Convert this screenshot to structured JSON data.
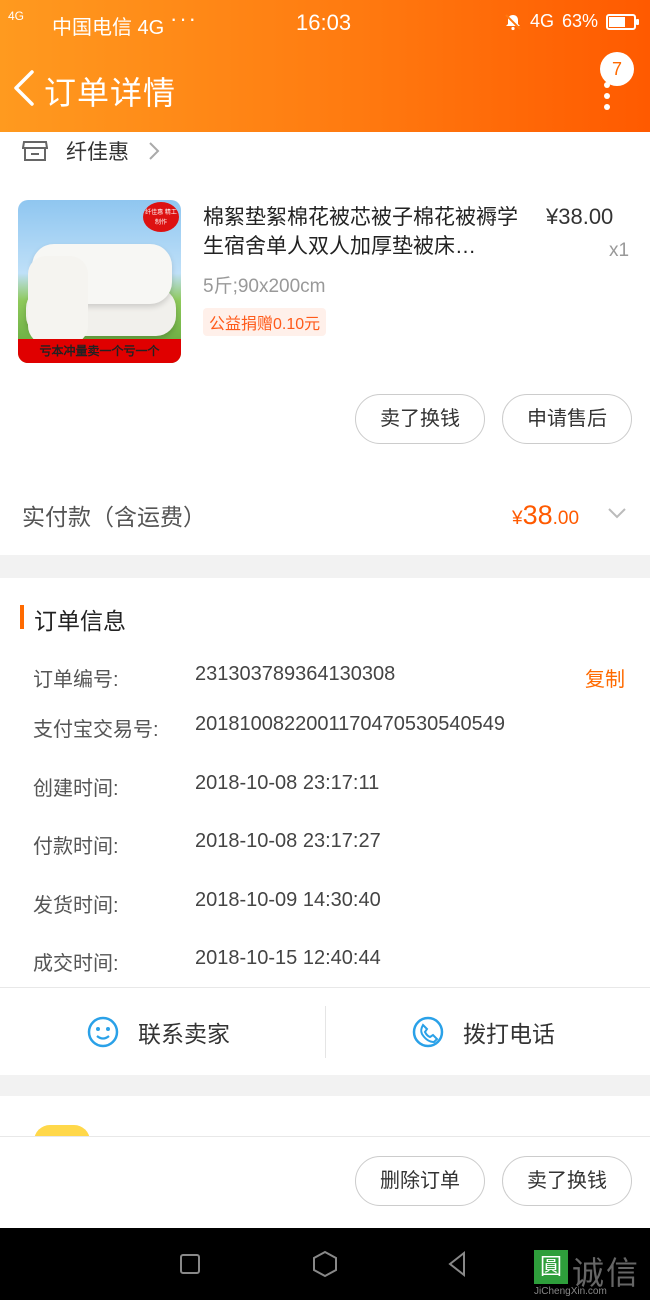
{
  "status_bar": {
    "network_small": "4G",
    "carrier": "中国电信 4G",
    "dots": "···",
    "time": "16:03",
    "network": "4G",
    "battery": "63%"
  },
  "header": {
    "title": "订单详情",
    "badge_count": "7"
  },
  "shop": {
    "name": "纤佳惠"
  },
  "product": {
    "title": "棉絮垫絮棉花被芯被子棉花被褥学生宿舍单人双人加厚垫被床…",
    "price": "¥38.00",
    "quantity": "x1",
    "spec": "5斤;90x200cm",
    "donation": "公益捐赠0.10元",
    "image_banner": "亏本冲量卖一个亏一个",
    "image_stamp": "纤佳惠 精工制作"
  },
  "item_actions": {
    "sell_label": "卖了换钱",
    "aftersale_label": "申请售后"
  },
  "payment": {
    "label": "实付款（含运费）",
    "currency": "¥",
    "integer": "38",
    "decimal": ".00"
  },
  "order_info": {
    "title": "订单信息",
    "copy_label": "复制",
    "rows": [
      {
        "label": "订单编号:",
        "value": "231303789364130308"
      },
      {
        "label": "支付宝交易号:",
        "value": "2018100822001170470530540549"
      },
      {
        "label": "创建时间:",
        "value": "2018-10-08 23:17:11"
      },
      {
        "label": "付款时间:",
        "value": "2018-10-08 23:17:27"
      },
      {
        "label": "发货时间:",
        "value": "2018-10-09 14:30:40"
      },
      {
        "label": "成交时间:",
        "value": "2018-10-15 12:40:44"
      }
    ]
  },
  "contact": {
    "seller_label": "联系卖家",
    "call_label": "拨打电话"
  },
  "bottom_actions": {
    "delete_label": "删除订单",
    "sell_label": "卖了换钱"
  },
  "watermark": {
    "box": "圓",
    "text": "诚信",
    "sub": "JiChengXin.com"
  },
  "colors": {
    "accent": "#ff6a00",
    "header_start": "#ff9a1f",
    "header_end": "#ff5a00"
  }
}
